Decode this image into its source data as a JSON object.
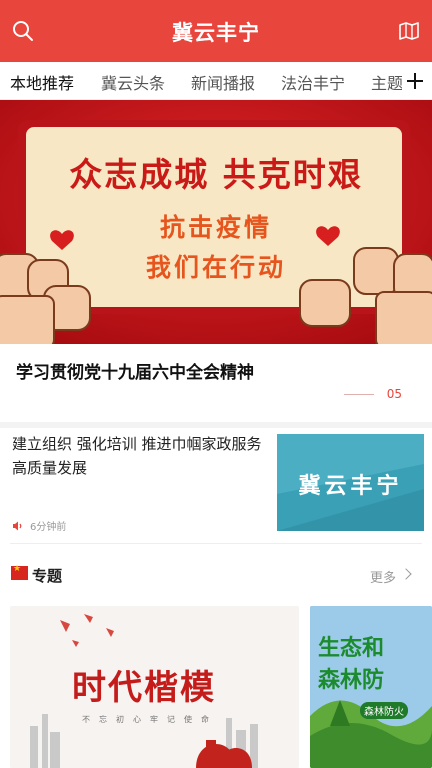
{
  "header": {
    "title": "冀云丰宁",
    "search_icon": "search-icon",
    "map_icon": "map-icon"
  },
  "tabs": [
    {
      "label": "本地推荐",
      "active": true
    },
    {
      "label": "冀云头条"
    },
    {
      "label": "新闻播报"
    },
    {
      "label": "法治丰宁"
    },
    {
      "label": "主题"
    }
  ],
  "banner": {
    "line1": "众志成城 共克时艰",
    "line2": "抗击疫情",
    "line3": "我们在行动",
    "headline": "学习贯彻党十九届六中全会精神",
    "page": "05"
  },
  "news": {
    "title": "建立组织 强化培训 推进巾帼家政服务高质量发展",
    "time": "6分钟前",
    "thumb_text": "冀云丰宁"
  },
  "section": {
    "title": "专题",
    "more": "更多"
  },
  "cards": {
    "card1_title": "时代楷模",
    "card1_sub": "不忘初心牢记使命",
    "card2_line1": "生态和",
    "card2_line2": "森林防",
    "card2_tag": "森林防火"
  },
  "colors": {
    "brand": "#e8453c",
    "banner_red": "#c8141a"
  }
}
